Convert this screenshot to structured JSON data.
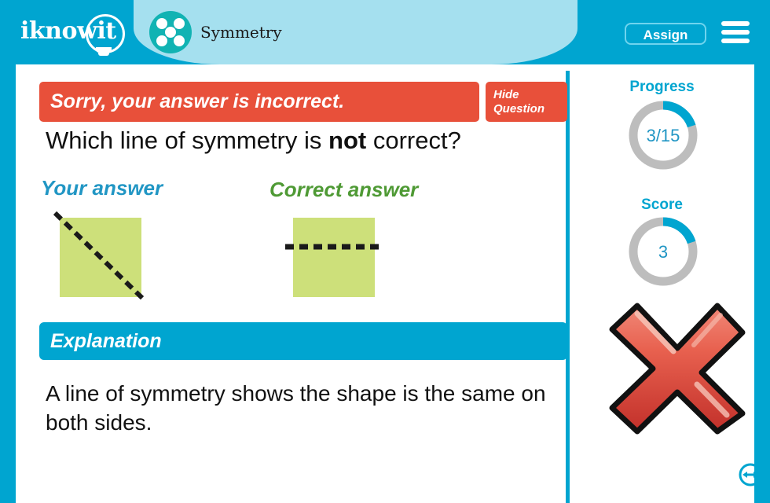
{
  "header": {
    "brand": "iknowit",
    "brand_icon": "lightbulb-icon",
    "subject_title": "Symmetry",
    "subject_icon": "five-dot-symmetry-icon",
    "assign_label": "Assign",
    "menu_icon": "hamburger-menu-icon",
    "bar_color": "#00a5d0",
    "tab_color": "#a5e0ef",
    "subject_icon_color": "#11b3b3"
  },
  "banner": {
    "result_text": "Sorry, your answer is incorrect.",
    "hide_question_line1": "Hide",
    "hide_question_line2": "Question",
    "color": "#e8503a"
  },
  "question": {
    "prefix": "Which line of symmetry is ",
    "emphasis": "not",
    "suffix": " correct?"
  },
  "answers": {
    "your_answer_label": "Your answer",
    "your_answer_color": "#2196c4",
    "correct_answer_label": "Correct answer",
    "correct_answer_color": "#4f9a35",
    "shape_fill": "#cde07a",
    "line_color": "#1a1a1a",
    "your_answer_shape": "square-with-diagonal-dashed-line",
    "correct_answer_shape": "square-with-horizontal-dashed-line"
  },
  "explanation": {
    "heading": "Explanation",
    "body": "A line of symmetry shows the shape is the same on both sides.",
    "heading_color": "#00a5d0"
  },
  "sidebar": {
    "progress_title": "Progress",
    "progress_value": "3/15",
    "progress_current": 3,
    "progress_total": 15,
    "progress_percent": 20,
    "score_title": "Score",
    "score_value": "3",
    "score_percent": 20,
    "ring_track_color": "#bdbdbd",
    "ring_fill_color": "#00a5d0",
    "result_icon": "red-x-incorrect-icon",
    "result_icon_color": "#e0564a",
    "resize_icon": "resize-horizontal-arrows-icon",
    "resize_icon_color": "#00a5d0"
  }
}
